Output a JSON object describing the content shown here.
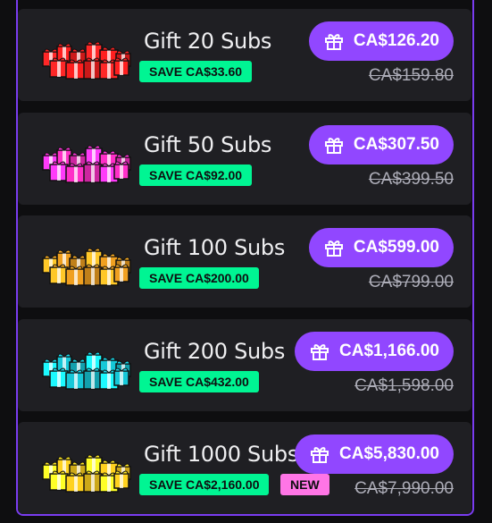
{
  "offers": [
    {
      "title": "Gift 20 Subs",
      "save": "SAVE CA$33.60",
      "price": "CA$126.20",
      "old_price": "CA$159.80",
      "color": "#ff1f1f",
      "new": ""
    },
    {
      "title": "Gift 50 Subs",
      "save": "SAVE CA$92.00",
      "price": "CA$307.50",
      "old_price": "CA$399.50",
      "color": "#ff2fc8",
      "new": ""
    },
    {
      "title": "Gift 100 Subs",
      "save": "SAVE CA$200.00",
      "price": "CA$599.00",
      "old_price": "CA$799.00",
      "color": "#f0a020",
      "new": ""
    },
    {
      "title": "Gift 200 Subs",
      "save": "SAVE CA$432.00",
      "price": "CA$1,166.00",
      "old_price": "CA$1,598.00",
      "color": "#16c8d8",
      "new": ""
    },
    {
      "title": "Gift 1000 Subs",
      "save": "SAVE CA$2,160.00",
      "price": "CA$5,830.00",
      "old_price": "CA$7,990.00",
      "color": "#ffd21f",
      "new": "NEW"
    }
  ],
  "icons": {
    "gift": "gift-icon",
    "thumbnail": "gift-boxes-pile-icon"
  },
  "colors": {
    "accent": "#9147ff",
    "save_badge": "#00f593",
    "new_badge": "#ff75e6",
    "row_bg": "#1f1f23",
    "border": "#7a3cf0"
  }
}
